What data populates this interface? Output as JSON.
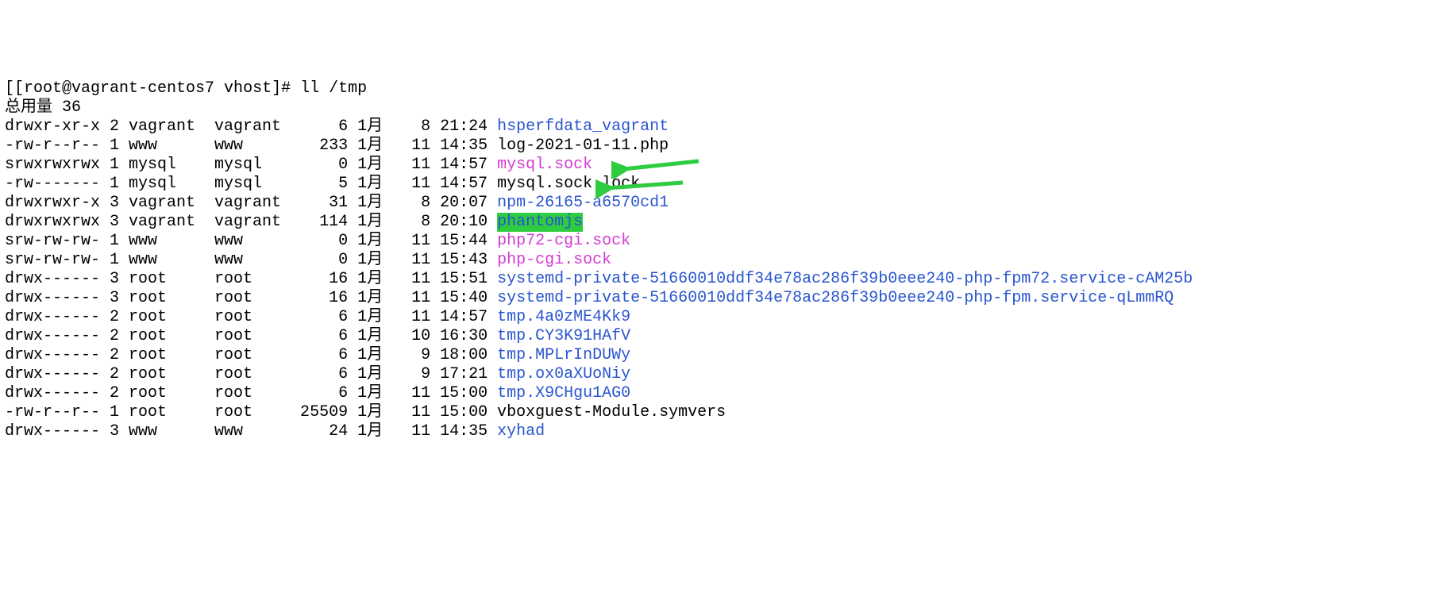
{
  "prompt": {
    "bracket": "[",
    "text": "[root@vagrant-centos7 vhost]# ",
    "command": "ll /tmp"
  },
  "total_line": "总用量 36",
  "rows": [
    {
      "perm": "drwxr-xr-x",
      "links": "2",
      "owner": "vagrant",
      "group": "vagrant",
      "size": "6",
      "mon": "1月",
      "day": "8",
      "time": "21:24",
      "name": "hsperfdata_vagrant",
      "cls": "dir-color"
    },
    {
      "perm": "-rw-r--r--",
      "links": "1",
      "owner": "www",
      "group": "www",
      "size": "233",
      "mon": "1月",
      "day": "11",
      "time": "14:35",
      "name": "log-2021-01-11.php",
      "cls": "file-color"
    },
    {
      "perm": "srwxrwxrwx",
      "links": "1",
      "owner": "mysql",
      "group": "mysql",
      "size": "0",
      "mon": "1月",
      "day": "11",
      "time": "14:57",
      "name": "mysql.sock",
      "cls": "sock-color"
    },
    {
      "perm": "-rw-------",
      "links": "1",
      "owner": "mysql",
      "group": "mysql",
      "size": "5",
      "mon": "1月",
      "day": "11",
      "time": "14:57",
      "name": "mysql.sock.lock",
      "cls": "file-color"
    },
    {
      "perm": "drwxrwxr-x",
      "links": "3",
      "owner": "vagrant",
      "group": "vagrant",
      "size": "31",
      "mon": "1月",
      "day": "8",
      "time": "20:07",
      "name": "npm-26165-a6570cd1",
      "cls": "dir-color"
    },
    {
      "perm": "drwxrwxrwx",
      "links": "3",
      "owner": "vagrant",
      "group": "vagrant",
      "size": "114",
      "mon": "1月",
      "day": "8",
      "time": "20:10",
      "name": "phantomjs",
      "cls": "hl-green"
    },
    {
      "perm": "srw-rw-rw-",
      "links": "1",
      "owner": "www",
      "group": "www",
      "size": "0",
      "mon": "1月",
      "day": "11",
      "time": "15:44",
      "name": "php72-cgi.sock",
      "cls": "sock-color"
    },
    {
      "perm": "srw-rw-rw-",
      "links": "1",
      "owner": "www",
      "group": "www",
      "size": "0",
      "mon": "1月",
      "day": "11",
      "time": "15:43",
      "name": "php-cgi.sock",
      "cls": "sock-color"
    },
    {
      "perm": "drwx------",
      "links": "3",
      "owner": "root",
      "group": "root",
      "size": "16",
      "mon": "1月",
      "day": "11",
      "time": "15:51",
      "name": "systemd-private-51660010ddf34e78ac286f39b0eee240-php-fpm72.service-cAM25b",
      "cls": "dir-color"
    },
    {
      "perm": "drwx------",
      "links": "3",
      "owner": "root",
      "group": "root",
      "size": "16",
      "mon": "1月",
      "day": "11",
      "time": "15:40",
      "name": "systemd-private-51660010ddf34e78ac286f39b0eee240-php-fpm.service-qLmmRQ",
      "cls": "dir-color"
    },
    {
      "perm": "drwx------",
      "links": "2",
      "owner": "root",
      "group": "root",
      "size": "6",
      "mon": "1月",
      "day": "11",
      "time": "14:57",
      "name": "tmp.4a0zME4Kk9",
      "cls": "dir-color"
    },
    {
      "perm": "drwx------",
      "links": "2",
      "owner": "root",
      "group": "root",
      "size": "6",
      "mon": "1月",
      "day": "10",
      "time": "16:30",
      "name": "tmp.CY3K91HAfV",
      "cls": "dir-color"
    },
    {
      "perm": "drwx------",
      "links": "2",
      "owner": "root",
      "group": "root",
      "size": "6",
      "mon": "1月",
      "day": "9",
      "time": "18:00",
      "name": "tmp.MPLrInDUWy",
      "cls": "dir-color"
    },
    {
      "perm": "drwx------",
      "links": "2",
      "owner": "root",
      "group": "root",
      "size": "6",
      "mon": "1月",
      "day": "9",
      "time": "17:21",
      "name": "tmp.ox0aXUoNiy",
      "cls": "dir-color"
    },
    {
      "perm": "drwx------",
      "links": "2",
      "owner": "root",
      "group": "root",
      "size": "6",
      "mon": "1月",
      "day": "11",
      "time": "15:00",
      "name": "tmp.X9CHgu1AG0",
      "cls": "dir-color"
    },
    {
      "perm": "-rw-r--r--",
      "links": "1",
      "owner": "root",
      "group": "root",
      "size": "25509",
      "mon": "1月",
      "day": "11",
      "time": "15:00",
      "name": "vboxguest-Module.symvers",
      "cls": "file-color"
    },
    {
      "perm": "drwx------",
      "links": "3",
      "owner": "www",
      "group": "www",
      "size": "24",
      "mon": "1月",
      "day": "11",
      "time": "14:35",
      "name": "xyhad",
      "cls": "dir-color"
    }
  ]
}
